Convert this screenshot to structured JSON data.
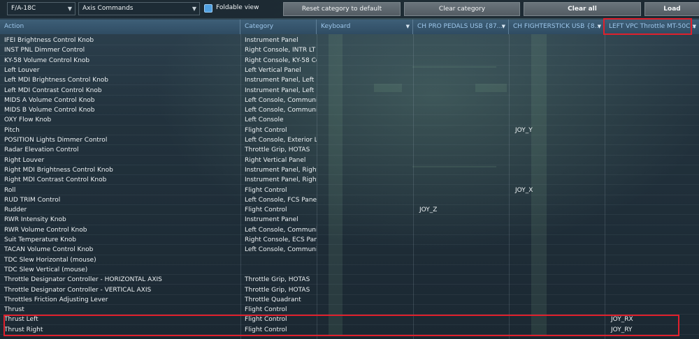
{
  "toolbar": {
    "aircraft": "F/A-18C",
    "category": "Axis Commands",
    "foldable_label": "Foldable view",
    "reset_label": "Reset category to default",
    "clear_category_label": "Clear category",
    "clear_all_label": "Clear all",
    "load_label": "Load"
  },
  "columns": {
    "action": "Action",
    "category": "Category",
    "keyboard": "Keyboard",
    "pedals": "CH PRO PEDALS USB  {87...",
    "stick": "CH FIGHTERSTICK USB  {8...",
    "throttle": "LEFT VPC Throttle MT-50C..."
  },
  "rows": [
    {
      "action": "IFEI Brightness Control Knob",
      "category": "Instrument Panel",
      "pedals": "",
      "stick": "",
      "throttle": ""
    },
    {
      "action": "INST PNL Dimmer Control",
      "category": "Right Console, INTR LT Co",
      "pedals": "",
      "stick": "",
      "throttle": ""
    },
    {
      "action": "KY-58 Volume Control Knob",
      "category": "Right Console, KY-58 Cont",
      "pedals": "",
      "stick": "",
      "throttle": ""
    },
    {
      "action": "Left Louver",
      "category": "Left Vertical Panel",
      "pedals": "",
      "stick": "",
      "throttle": ""
    },
    {
      "action": "Left MDI Brightness Control Knob",
      "category": "Instrument Panel, Left MD",
      "pedals": "",
      "stick": "",
      "throttle": ""
    },
    {
      "action": "Left MDI Contrast Control Knob",
      "category": "Instrument Panel, Left MD",
      "pedals": "",
      "stick": "",
      "throttle": ""
    },
    {
      "action": "MIDS A Volume Control Knob",
      "category": "Left Console, Communicat",
      "pedals": "",
      "stick": "",
      "throttle": ""
    },
    {
      "action": "MIDS B Volume Control Knob",
      "category": "Left Console, Communicat",
      "pedals": "",
      "stick": "",
      "throttle": ""
    },
    {
      "action": "OXY Flow Knob",
      "category": "Left Console",
      "pedals": "",
      "stick": "",
      "throttle": ""
    },
    {
      "action": "Pitch",
      "category": "Flight Control",
      "pedals": "",
      "stick": "JOY_Y",
      "throttle": ""
    },
    {
      "action": "POSITION Lights Dimmer Control",
      "category": "Left Console, Exterior Ligh",
      "pedals": "",
      "stick": "",
      "throttle": ""
    },
    {
      "action": "Radar Elevation Control",
      "category": "Throttle Grip, HOTAS",
      "pedals": "",
      "stick": "",
      "throttle": ""
    },
    {
      "action": "Right Louver",
      "category": "Right Vertical Panel",
      "pedals": "",
      "stick": "",
      "throttle": ""
    },
    {
      "action": "Right MDI Brightness Control Knob",
      "category": "Instrument Panel, Right M",
      "pedals": "",
      "stick": "",
      "throttle": ""
    },
    {
      "action": "Right MDI Contrast Control Knob",
      "category": "Instrument Panel, Right M",
      "pedals": "",
      "stick": "",
      "throttle": ""
    },
    {
      "action": "Roll",
      "category": "Flight Control",
      "pedals": "",
      "stick": "JOY_X",
      "throttle": ""
    },
    {
      "action": "RUD TRIM Control",
      "category": "Left Console, FCS Panel",
      "pedals": "",
      "stick": "",
      "throttle": ""
    },
    {
      "action": "Rudder",
      "category": "Flight Control",
      "pedals": "JOY_Z",
      "stick": "",
      "throttle": ""
    },
    {
      "action": "RWR Intensity Knob",
      "category": "Instrument Panel",
      "pedals": "",
      "stick": "",
      "throttle": ""
    },
    {
      "action": "RWR Volume Control Knob",
      "category": "Left Console, Communicat",
      "pedals": "",
      "stick": "",
      "throttle": ""
    },
    {
      "action": "Suit Temperature Knob",
      "category": "Right Console, ECS Panel",
      "pedals": "",
      "stick": "",
      "throttle": ""
    },
    {
      "action": "TACAN Volume Control Knob",
      "category": "Left Console, Communicat",
      "pedals": "",
      "stick": "",
      "throttle": ""
    },
    {
      "action": "TDC Slew Horizontal (mouse)",
      "category": "",
      "pedals": "",
      "stick": "",
      "throttle": ""
    },
    {
      "action": "TDC Slew Vertical (mouse)",
      "category": "",
      "pedals": "",
      "stick": "",
      "throttle": ""
    },
    {
      "action": "Throttle Designator Controller - HORIZONTAL AXIS",
      "category": "Throttle Grip, HOTAS",
      "pedals": "",
      "stick": "",
      "throttle": ""
    },
    {
      "action": "Throttle Designator Controller - VERTICAL AXIS",
      "category": "Throttle Grip, HOTAS",
      "pedals": "",
      "stick": "",
      "throttle": ""
    },
    {
      "action": "Throttles Friction Adjusting Lever",
      "category": "Throttle Quadrant",
      "pedals": "",
      "stick": "",
      "throttle": ""
    },
    {
      "action": "Thrust",
      "category": "Flight Control",
      "pedals": "",
      "stick": "",
      "throttle": ""
    },
    {
      "action": "Thrust Left",
      "category": "Flight Control",
      "pedals": "",
      "stick": "",
      "throttle": "JOY_RX"
    },
    {
      "action": "Thrust Right",
      "category": "Flight Control",
      "pedals": "",
      "stick": "",
      "throttle": "JOY_RY"
    }
  ],
  "colors": {
    "highlight": "#e0202c",
    "header_text": "#9cc6ea",
    "checkbox": "#4f9fe0"
  }
}
